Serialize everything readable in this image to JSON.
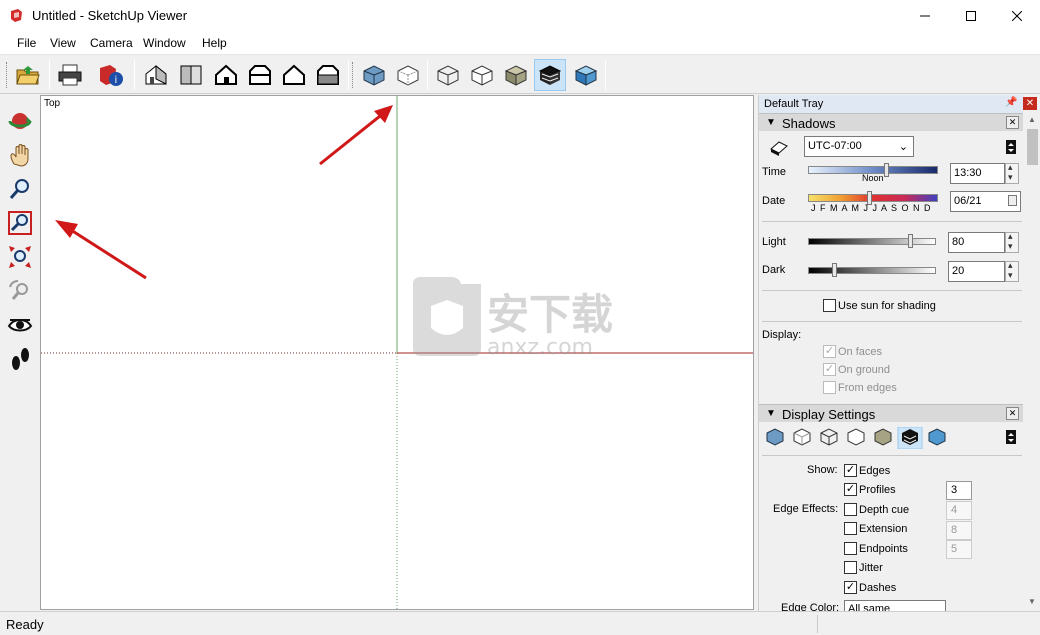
{
  "window": {
    "title": "Untitled - SketchUp Viewer",
    "app_icon": "sketchup-icon"
  },
  "menu": [
    "File",
    "View",
    "Camera",
    "Window",
    "Help"
  ],
  "viewport": {
    "view_label": "Top",
    "watermark_text": "anxz.com",
    "watermark_cn": "安下载"
  },
  "status": {
    "text": "Ready"
  },
  "tray": {
    "title": "Default Tray",
    "shadows": {
      "heading": "Shadows",
      "timezone": "UTC-07:00",
      "time_label": "Time",
      "time_value": "13:30",
      "noon_label": "Noon",
      "time_fraction": 0.6,
      "date_label": "Date",
      "date_value": "06/21",
      "months": "J F M A M J J A S O N D",
      "date_fraction": 0.47,
      "light_label": "Light",
      "light_value": "80",
      "dark_label": "Dark",
      "dark_value": "20",
      "use_sun": "Use sun for shading",
      "display_label": "Display:",
      "on_faces": "On faces",
      "on_ground": "On ground",
      "from_edges": "From edges"
    },
    "display_settings": {
      "heading": "Display Settings",
      "show_label": "Show:",
      "edge_effects_label": "Edge Effects:",
      "edges": "Edges",
      "profiles": "Profiles",
      "profiles_value": "3",
      "depth_cue": "Depth cue",
      "depth_cue_value": "4",
      "extension": "Extension",
      "extension_value": "8",
      "endpoints": "Endpoints",
      "endpoints_value": "5",
      "jitter": "Jitter",
      "dashes": "Dashes",
      "edge_color_label": "Edge Color:",
      "edge_color_value": "All same"
    }
  },
  "colors": {
    "accent": "#cce4f7",
    "red_axis": "#a02020",
    "green_axis": "#4a9a4a",
    "arrow": "#d01818"
  }
}
